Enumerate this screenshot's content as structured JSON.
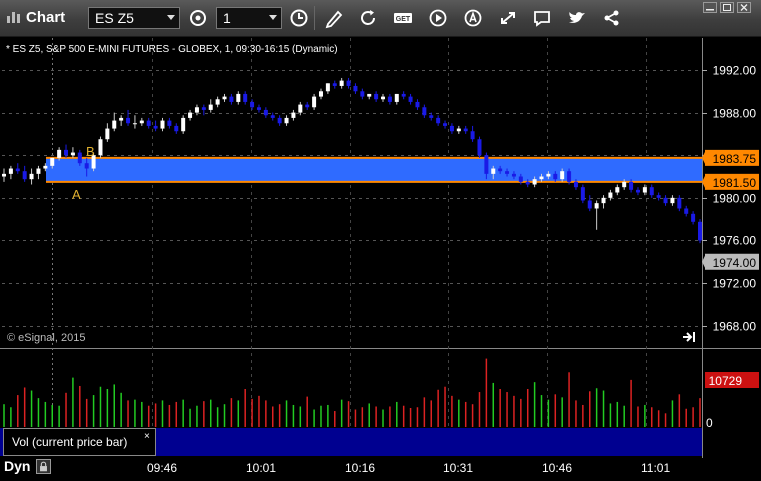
{
  "toolbar": {
    "app_title": "Chart",
    "symbol": "ES Z5",
    "interval": "1"
  },
  "chart": {
    "header": "* ES Z5, S&P 500 E-MINI FUTURES - GLOBEX, 1, 09:30-16:15 (Dynamic)",
    "watermark": "© eSignal, 2015",
    "price_ticks": [
      "1992.00",
      "1988.00",
      "1984.00",
      "1980.00",
      "1976.00",
      "1972.00",
      "1968.00"
    ],
    "price_tick_values": [
      1992,
      1988,
      1984,
      1980,
      1976,
      1972,
      1968
    ],
    "zone_top_label": "1983.75",
    "zone_bottom_label": "1981.50",
    "zone_top": 1983.75,
    "zone_bottom": 1981.5,
    "last_price_label": "1974.00",
    "last_price": 1974.0,
    "marker_a": "A",
    "marker_b": "B",
    "zone_color": "#2f6bff",
    "zone_line_color": "#ff8800",
    "up_color": "#ffffff",
    "down_color": "#1a1ae6"
  },
  "volume": {
    "label": "Vol (current price bar)",
    "close_symbol": "×",
    "last_label": "10729",
    "zero_label": "0",
    "up_color": "#22cc22",
    "down_color": "#dd2222"
  },
  "footer": {
    "dyn_label": "Dyn",
    "time_ticks": [
      "09:46",
      "10:01",
      "10:16",
      "10:31",
      "10:46",
      "11:01"
    ]
  },
  "chart_data": {
    "type": "candlestick",
    "y_range": [
      1966,
      1995
    ],
    "x": [
      "09:30",
      "09:31",
      "09:32",
      "09:33",
      "09:34",
      "09:35",
      "09:36",
      "09:37",
      "09:38",
      "09:39",
      "09:40",
      "09:41",
      "09:42",
      "09:43",
      "09:44",
      "09:45",
      "09:46",
      "09:47",
      "09:48",
      "09:49",
      "09:50",
      "09:51",
      "09:52",
      "09:53",
      "09:54",
      "09:55",
      "09:56",
      "09:57",
      "09:58",
      "09:59",
      "10:00",
      "10:01",
      "10:02",
      "10:03",
      "10:04",
      "10:05",
      "10:06",
      "10:07",
      "10:08",
      "10:09",
      "10:10",
      "10:11",
      "10:12",
      "10:13",
      "10:14",
      "10:15",
      "10:16",
      "10:17",
      "10:18",
      "10:19",
      "10:20",
      "10:21",
      "10:22",
      "10:23",
      "10:24",
      "10:25",
      "10:26",
      "10:27",
      "10:28",
      "10:29",
      "10:30",
      "10:31",
      "10:32",
      "10:33",
      "10:34",
      "10:35",
      "10:36",
      "10:37",
      "10:38",
      "10:39",
      "10:40",
      "10:41",
      "10:42",
      "10:43",
      "10:44",
      "10:45",
      "10:46",
      "10:47",
      "10:48",
      "10:49",
      "10:50",
      "10:51",
      "10:52",
      "10:53",
      "10:54",
      "10:55",
      "10:56",
      "10:57",
      "10:58",
      "10:59",
      "11:00",
      "11:01",
      "11:02",
      "11:03",
      "11:04",
      "11:05",
      "11:06",
      "11:07",
      "11:08",
      "11:09",
      "11:10",
      "11:11"
    ],
    "open": [
      1982.0,
      1982.25,
      1982.75,
      1982.5,
      1981.75,
      1982.25,
      1982.75,
      1983.0,
      1983.75,
      1984.5,
      1984.0,
      1984.25,
      1983.25,
      1982.75,
      1984.0,
      1985.5,
      1986.5,
      1987.25,
      1987.5,
      1987.0,
      1987.0,
      1987.25,
      1986.75,
      1986.5,
      1987.25,
      1986.75,
      1986.25,
      1987.5,
      1988.0,
      1988.5,
      1988.25,
      1988.75,
      1989.25,
      1989.5,
      1989.0,
      1989.75,
      1989.0,
      1988.5,
      1988.25,
      1987.75,
      1987.5,
      1987.0,
      1987.5,
      1988.0,
      1988.75,
      1988.5,
      1989.5,
      1990.0,
      1990.75,
      1990.5,
      1991.0,
      1990.5,
      1990.0,
      1989.5,
      1989.75,
      1989.25,
      1989.5,
      1989.0,
      1989.75,
      1989.5,
      1989.0,
      1988.5,
      1987.75,
      1987.5,
      1987.0,
      1986.75,
      1986.25,
      1986.5,
      1986.25,
      1985.5,
      1984.0,
      1982.25,
      1982.75,
      1982.5,
      1982.25,
      1982.0,
      1981.5,
      1981.25,
      1981.75,
      1982.0,
      1982.25,
      1981.75,
      1982.5,
      1981.5,
      1981.0,
      1979.75,
      1979.0,
      1979.5,
      1980.0,
      1980.5,
      1981.0,
      1981.5,
      1980.75,
      1980.5,
      1981.0,
      1980.25,
      1980.0,
      1979.5,
      1980.0,
      1979.0,
      1978.5,
      1977.75
    ],
    "high": [
      1982.75,
      1983.0,
      1983.25,
      1983.0,
      1982.75,
      1983.0,
      1983.25,
      1983.75,
      1984.75,
      1985.0,
      1984.75,
      1984.5,
      1983.75,
      1984.25,
      1985.75,
      1987.0,
      1988.0,
      1987.75,
      1988.25,
      1987.75,
      1987.5,
      1987.5,
      1987.25,
      1987.5,
      1987.5,
      1987.0,
      1987.75,
      1988.25,
      1988.75,
      1988.75,
      1989.25,
      1989.5,
      1989.75,
      1989.75,
      1990.0,
      1990.0,
      1989.25,
      1988.75,
      1988.5,
      1988.0,
      1987.75,
      1987.75,
      1988.25,
      1989.0,
      1989.0,
      1989.75,
      1990.25,
      1990.75,
      1991.0,
      1991.25,
      1991.25,
      1990.75,
      1990.25,
      1989.75,
      1990.0,
      1989.75,
      1989.75,
      1989.75,
      1990.0,
      1989.75,
      1989.25,
      1988.75,
      1988.0,
      1987.75,
      1987.25,
      1987.0,
      1986.75,
      1986.75,
      1986.75,
      1985.75,
      1984.25,
      1983.0,
      1983.0,
      1982.75,
      1982.5,
      1982.25,
      1981.75,
      1982.0,
      1982.25,
      1982.5,
      1982.5,
      1982.75,
      1982.75,
      1981.75,
      1981.25,
      1980.25,
      1979.75,
      1980.25,
      1980.75,
      1981.25,
      1981.75,
      1981.75,
      1981.0,
      1981.25,
      1981.25,
      1980.5,
      1980.25,
      1980.25,
      1980.25,
      1979.25,
      1978.75,
      1978.0
    ],
    "low": [
      1981.5,
      1981.75,
      1982.25,
      1981.5,
      1981.25,
      1981.75,
      1982.5,
      1982.75,
      1983.5,
      1983.75,
      1983.75,
      1983.0,
      1982.0,
      1982.5,
      1983.75,
      1985.25,
      1986.25,
      1986.75,
      1986.75,
      1986.5,
      1986.75,
      1986.5,
      1986.25,
      1986.25,
      1986.5,
      1986.0,
      1986.0,
      1987.25,
      1987.75,
      1987.75,
      1988.0,
      1988.5,
      1989.0,
      1988.75,
      1988.75,
      1988.75,
      1988.25,
      1988.0,
      1987.5,
      1987.25,
      1986.75,
      1986.75,
      1987.25,
      1987.75,
      1988.25,
      1988.25,
      1989.25,
      1989.75,
      1990.25,
      1990.25,
      1990.25,
      1989.75,
      1989.25,
      1989.25,
      1989.0,
      1989.0,
      1988.75,
      1988.75,
      1989.25,
      1988.75,
      1988.25,
      1987.5,
      1987.25,
      1986.75,
      1986.5,
      1986.0,
      1986.0,
      1986.0,
      1985.25,
      1983.75,
      1981.75,
      1981.75,
      1982.25,
      1982.0,
      1981.75,
      1981.25,
      1981.0,
      1981.0,
      1981.5,
      1981.75,
      1981.5,
      1981.5,
      1981.25,
      1980.75,
      1979.5,
      1978.75,
      1977.0,
      1979.0,
      1979.75,
      1980.25,
      1980.75,
      1980.5,
      1980.25,
      1980.25,
      1980.0,
      1979.75,
      1979.25,
      1979.25,
      1978.75,
      1978.25,
      1977.5,
      1975.75
    ],
    "close": [
      1982.25,
      1982.75,
      1982.5,
      1981.75,
      1982.25,
      1982.75,
      1983.0,
      1983.75,
      1984.5,
      1984.0,
      1984.25,
      1983.25,
      1982.75,
      1984.0,
      1985.5,
      1986.5,
      1987.25,
      1987.5,
      1987.0,
      1987.0,
      1987.25,
      1986.75,
      1986.5,
      1987.25,
      1986.75,
      1986.25,
      1987.5,
      1988.0,
      1988.5,
      1988.25,
      1988.75,
      1989.25,
      1989.5,
      1989.0,
      1989.75,
      1989.0,
      1988.5,
      1988.25,
      1987.75,
      1987.5,
      1987.0,
      1987.5,
      1988.0,
      1988.75,
      1988.5,
      1989.5,
      1990.0,
      1990.75,
      1990.5,
      1991.0,
      1990.5,
      1990.0,
      1989.5,
      1989.75,
      1989.25,
      1989.5,
      1989.0,
      1989.75,
      1989.5,
      1989.0,
      1988.5,
      1987.75,
      1987.5,
      1987.0,
      1986.75,
      1986.25,
      1986.5,
      1986.25,
      1985.5,
      1984.0,
      1982.25,
      1982.75,
      1982.5,
      1982.25,
      1982.0,
      1981.5,
      1981.25,
      1981.75,
      1982.0,
      1982.25,
      1981.75,
      1982.5,
      1981.5,
      1981.0,
      1979.75,
      1979.0,
      1979.5,
      1980.0,
      1980.5,
      1981.0,
      1981.5,
      1980.75,
      1980.5,
      1981.0,
      1980.25,
      1980.0,
      1979.5,
      1980.0,
      1979.0,
      1978.5,
      1977.75,
      1976.0
    ],
    "volume": [
      3000,
      2600,
      4200,
      5200,
      4800,
      3800,
      3300,
      2900,
      2800,
      4500,
      6500,
      5400,
      3700,
      4200,
      5300,
      5000,
      5600,
      4500,
      3500,
      3600,
      3300,
      2800,
      3100,
      3500,
      2900,
      3300,
      3600,
      2400,
      2800,
      3400,
      3600,
      2600,
      3000,
      3800,
      3500,
      5000,
      3700,
      4100,
      3500,
      2700,
      3000,
      3500,
      2900,
      2700,
      4000,
      2300,
      2800,
      2900,
      2100,
      3600,
      3400,
      2300,
      2600,
      3100,
      2700,
      2300,
      2700,
      3300,
      2800,
      2500,
      2600,
      3900,
      3500,
      4900,
      5300,
      4100,
      3600,
      3300,
      3000,
      4600,
      9000,
      5800,
      5000,
      4600,
      4100,
      3700,
      5000,
      5900,
      4200,
      3600,
      4300,
      3900,
      7200,
      3500,
      2900,
      4700,
      5100,
      4800,
      3100,
      3300,
      2800,
      6200,
      2700,
      2900,
      2600,
      2200,
      1800,
      3500,
      4300,
      2400,
      2600,
      3800
    ],
    "volume_range": [
      0,
      10000
    ]
  }
}
